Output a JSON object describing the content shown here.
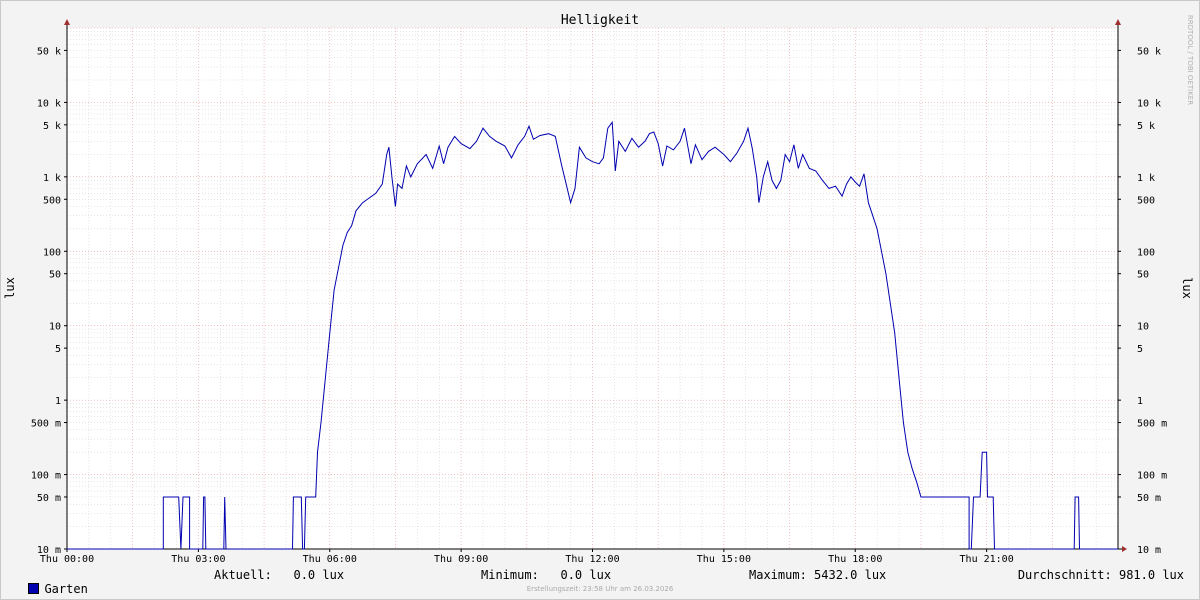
{
  "chart_data": {
    "type": "line",
    "title": "Helligkeit",
    "ylabel": "lux",
    "y_scale": "log",
    "ylim": [
      0.01,
      100000
    ],
    "y_ticks": [
      {
        "value": 50000,
        "label": "50 k"
      },
      {
        "value": 10000,
        "label": "10 k"
      },
      {
        "value": 5000,
        "label": "5 k"
      },
      {
        "value": 1000,
        "label": "1 k"
      },
      {
        "value": 500,
        "label": "500"
      },
      {
        "value": 100,
        "label": "100"
      },
      {
        "value": 50,
        "label": "50"
      },
      {
        "value": 10,
        "label": "10"
      },
      {
        "value": 5,
        "label": "5"
      },
      {
        "value": 1,
        "label": "1"
      },
      {
        "value": 0.5,
        "label": "500 m"
      },
      {
        "value": 0.1,
        "label": "100 m"
      },
      {
        "value": 0.05,
        "label": "50 m"
      },
      {
        "value": 0.01,
        "label": "10 m"
      }
    ],
    "x_unit": "hours",
    "xlim": [
      0,
      24
    ],
    "x_ticks": [
      {
        "value": 0,
        "label": "Thu 00:00"
      },
      {
        "value": 3,
        "label": "Thu 03:00"
      },
      {
        "value": 6,
        "label": "Thu 06:00"
      },
      {
        "value": 9,
        "label": "Thu 09:00"
      },
      {
        "value": 12,
        "label": "Thu 12:00"
      },
      {
        "value": 15,
        "label": "Thu 15:00"
      },
      {
        "value": 18,
        "label": "Thu 18:00"
      },
      {
        "value": 21,
        "label": "Thu 21:00"
      }
    ],
    "grid": true,
    "series": [
      {
        "name": "Garten",
        "color": "#0000b0",
        "points": [
          [
            0,
            0.01
          ],
          [
            2.2,
            0.01
          ],
          [
            2.2,
            0.05
          ],
          [
            2.55,
            0.05
          ],
          [
            2.6,
            0.01
          ],
          [
            2.65,
            0.05
          ],
          [
            2.8,
            0.05
          ],
          [
            2.8,
            0.01
          ],
          [
            3.1,
            0.01
          ],
          [
            3.12,
            0.05
          ],
          [
            3.15,
            0.05
          ],
          [
            3.17,
            0.01
          ],
          [
            3.58,
            0.01
          ],
          [
            3.6,
            0.05
          ],
          [
            3.63,
            0.01
          ],
          [
            5.15,
            0.01
          ],
          [
            5.17,
            0.05
          ],
          [
            5.35,
            0.05
          ],
          [
            5.38,
            0.01
          ],
          [
            5.42,
            0.01
          ],
          [
            5.45,
            0.05
          ],
          [
            5.68,
            0.05
          ],
          [
            5.72,
            0.2
          ],
          [
            5.8,
            0.5
          ],
          [
            5.9,
            2
          ],
          [
            6.0,
            8
          ],
          [
            6.1,
            30
          ],
          [
            6.2,
            60
          ],
          [
            6.3,
            120
          ],
          [
            6.4,
            180
          ],
          [
            6.5,
            220
          ],
          [
            6.6,
            350
          ],
          [
            6.75,
            450
          ],
          [
            6.9,
            520
          ],
          [
            7.05,
            600
          ],
          [
            7.2,
            800
          ],
          [
            7.3,
            2000
          ],
          [
            7.35,
            2500
          ],
          [
            7.42,
            1000
          ],
          [
            7.5,
            400
          ],
          [
            7.55,
            800
          ],
          [
            7.65,
            700
          ],
          [
            7.75,
            1400
          ],
          [
            7.85,
            1000
          ],
          [
            8.0,
            1500
          ],
          [
            8.2,
            2000
          ],
          [
            8.35,
            1300
          ],
          [
            8.5,
            2600
          ],
          [
            8.6,
            1500
          ],
          [
            8.7,
            2500
          ],
          [
            8.85,
            3500
          ],
          [
            9.0,
            2800
          ],
          [
            9.2,
            2400
          ],
          [
            9.35,
            3000
          ],
          [
            9.5,
            4500
          ],
          [
            9.65,
            3500
          ],
          [
            9.8,
            3000
          ],
          [
            10.0,
            2600
          ],
          [
            10.15,
            1800
          ],
          [
            10.3,
            2700
          ],
          [
            10.45,
            3500
          ],
          [
            10.55,
            4800
          ],
          [
            10.65,
            3200
          ],
          [
            10.8,
            3600
          ],
          [
            11.0,
            3800
          ],
          [
            11.15,
            3500
          ],
          [
            11.3,
            1400
          ],
          [
            11.4,
            800
          ],
          [
            11.5,
            450
          ],
          [
            11.6,
            700
          ],
          [
            11.7,
            2500
          ],
          [
            11.85,
            1800
          ],
          [
            12.0,
            1600
          ],
          [
            12.15,
            1500
          ],
          [
            12.25,
            1800
          ],
          [
            12.35,
            4500
          ],
          [
            12.45,
            5400
          ],
          [
            12.52,
            1200
          ],
          [
            12.6,
            3000
          ],
          [
            12.75,
            2200
          ],
          [
            12.9,
            3300
          ],
          [
            13.05,
            2500
          ],
          [
            13.2,
            3000
          ],
          [
            13.3,
            3800
          ],
          [
            13.4,
            4000
          ],
          [
            13.5,
            2800
          ],
          [
            13.6,
            1400
          ],
          [
            13.7,
            2600
          ],
          [
            13.85,
            2300
          ],
          [
            14.0,
            3000
          ],
          [
            14.1,
            4500
          ],
          [
            14.25,
            1500
          ],
          [
            14.35,
            2700
          ],
          [
            14.5,
            1700
          ],
          [
            14.65,
            2200
          ],
          [
            14.8,
            2500
          ],
          [
            15.0,
            2000
          ],
          [
            15.15,
            1600
          ],
          [
            15.3,
            2100
          ],
          [
            15.45,
            3000
          ],
          [
            15.55,
            4500
          ],
          [
            15.65,
            2400
          ],
          [
            15.75,
            1000
          ],
          [
            15.8,
            450
          ],
          [
            15.9,
            1000
          ],
          [
            16.0,
            1600
          ],
          [
            16.1,
            900
          ],
          [
            16.2,
            700
          ],
          [
            16.3,
            900
          ],
          [
            16.4,
            2000
          ],
          [
            16.5,
            1600
          ],
          [
            16.6,
            2700
          ],
          [
            16.7,
            1300
          ],
          [
            16.8,
            2000
          ],
          [
            16.95,
            1300
          ],
          [
            17.1,
            1200
          ],
          [
            17.25,
            900
          ],
          [
            17.4,
            700
          ],
          [
            17.55,
            750
          ],
          [
            17.7,
            550
          ],
          [
            17.8,
            800
          ],
          [
            17.9,
            1000
          ],
          [
            18.0,
            850
          ],
          [
            18.1,
            750
          ],
          [
            18.2,
            1100
          ],
          [
            18.3,
            450
          ],
          [
            18.4,
            300
          ],
          [
            18.5,
            200
          ],
          [
            18.6,
            100
          ],
          [
            18.7,
            50
          ],
          [
            18.8,
            20
          ],
          [
            18.9,
            8
          ],
          [
            19.0,
            2
          ],
          [
            19.1,
            0.5
          ],
          [
            19.2,
            0.2
          ],
          [
            19.3,
            0.12
          ],
          [
            19.4,
            0.08
          ],
          [
            19.5,
            0.05
          ],
          [
            20.6,
            0.05
          ],
          [
            20.6,
            0.01
          ],
          [
            20.65,
            0.01
          ],
          [
            20.7,
            0.05
          ],
          [
            20.85,
            0.05
          ],
          [
            20.9,
            0.2
          ],
          [
            21.0,
            0.2
          ],
          [
            21.02,
            0.05
          ],
          [
            21.15,
            0.05
          ],
          [
            21.18,
            0.01
          ],
          [
            23.0,
            0.01
          ],
          [
            23.02,
            0.05
          ],
          [
            23.1,
            0.05
          ],
          [
            23.12,
            0.01
          ],
          [
            24,
            0.01
          ]
        ]
      }
    ]
  },
  "watermark": "RRDTOOL / TOBI OETIKER",
  "legend": {
    "series_name": "Garten",
    "aktuell": "Aktuell:   0.0 lux",
    "minimum": "Minimum:   0.0 lux",
    "maximum": "Maximum: 5432.0 lux",
    "durchschnitt": "Durchschnitt: 981.0 lux"
  },
  "footer": "Erstellungszeit: 23:58 Uhr am 26.03.2026",
  "colors": {
    "line": "#0000b0",
    "major_grid": "#e8a0a0",
    "minor_grid": "#cccccc",
    "axis_arrow": "#a03030"
  }
}
